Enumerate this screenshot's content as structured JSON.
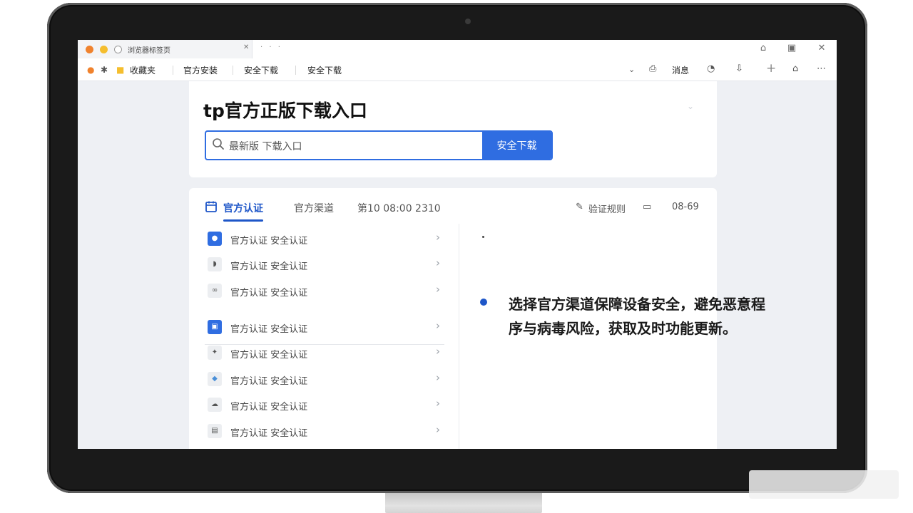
{
  "browser": {
    "tab_title": "浏览器标签页",
    "tab_close": "✕",
    "tab_extra": "· · ·",
    "window_controls": [
      "⌂",
      "▣",
      "✕"
    ],
    "toolbar_links": [
      "收藏夹",
      "官方安装",
      "安全下载",
      "安全下载"
    ],
    "toolbar_right_label": "消息",
    "toolbar_icons": [
      "history-icon",
      "clock-icon",
      "download-icon",
      "plus-icon",
      "home-icon",
      "more-icon"
    ]
  },
  "page": {
    "title": "tp官方正版下载入口",
    "search": {
      "placeholder": "最新版 下载入口",
      "button_label": "安全下载"
    }
  },
  "tabs": {
    "items": [
      "官方认证",
      "官方渠道",
      "第10 08:00 2310"
    ],
    "active_index": 0,
    "right_link": "验证规则",
    "right_value": "08-69"
  },
  "list": {
    "items": [
      {
        "label": "官方认证 安全认证",
        "icon": "chat-icon"
      },
      {
        "label": "官方认证 安全认证",
        "icon": "cup-icon"
      },
      {
        "label": "官方认证 安全认证",
        "icon": "link-icon"
      },
      {
        "label": "官方认证 安全认证",
        "icon": "image-icon"
      },
      {
        "label": "官方认证 安全认证",
        "icon": "tool-icon"
      },
      {
        "label": "官方认证 安全认证",
        "icon": "bird-icon"
      },
      {
        "label": "官方认证 安全认证",
        "icon": "cloud-icon"
      },
      {
        "label": "官方认证 安全认证",
        "icon": "card-icon"
      }
    ]
  },
  "info": {
    "text": "选择官方渠道保障设备安全，避免恶意程序与病毒风险，获取及时功能更新。"
  },
  "colors": {
    "accent": "#2f6de1",
    "tab_active": "#1e56c8",
    "bezel": "#1a1a1a"
  }
}
